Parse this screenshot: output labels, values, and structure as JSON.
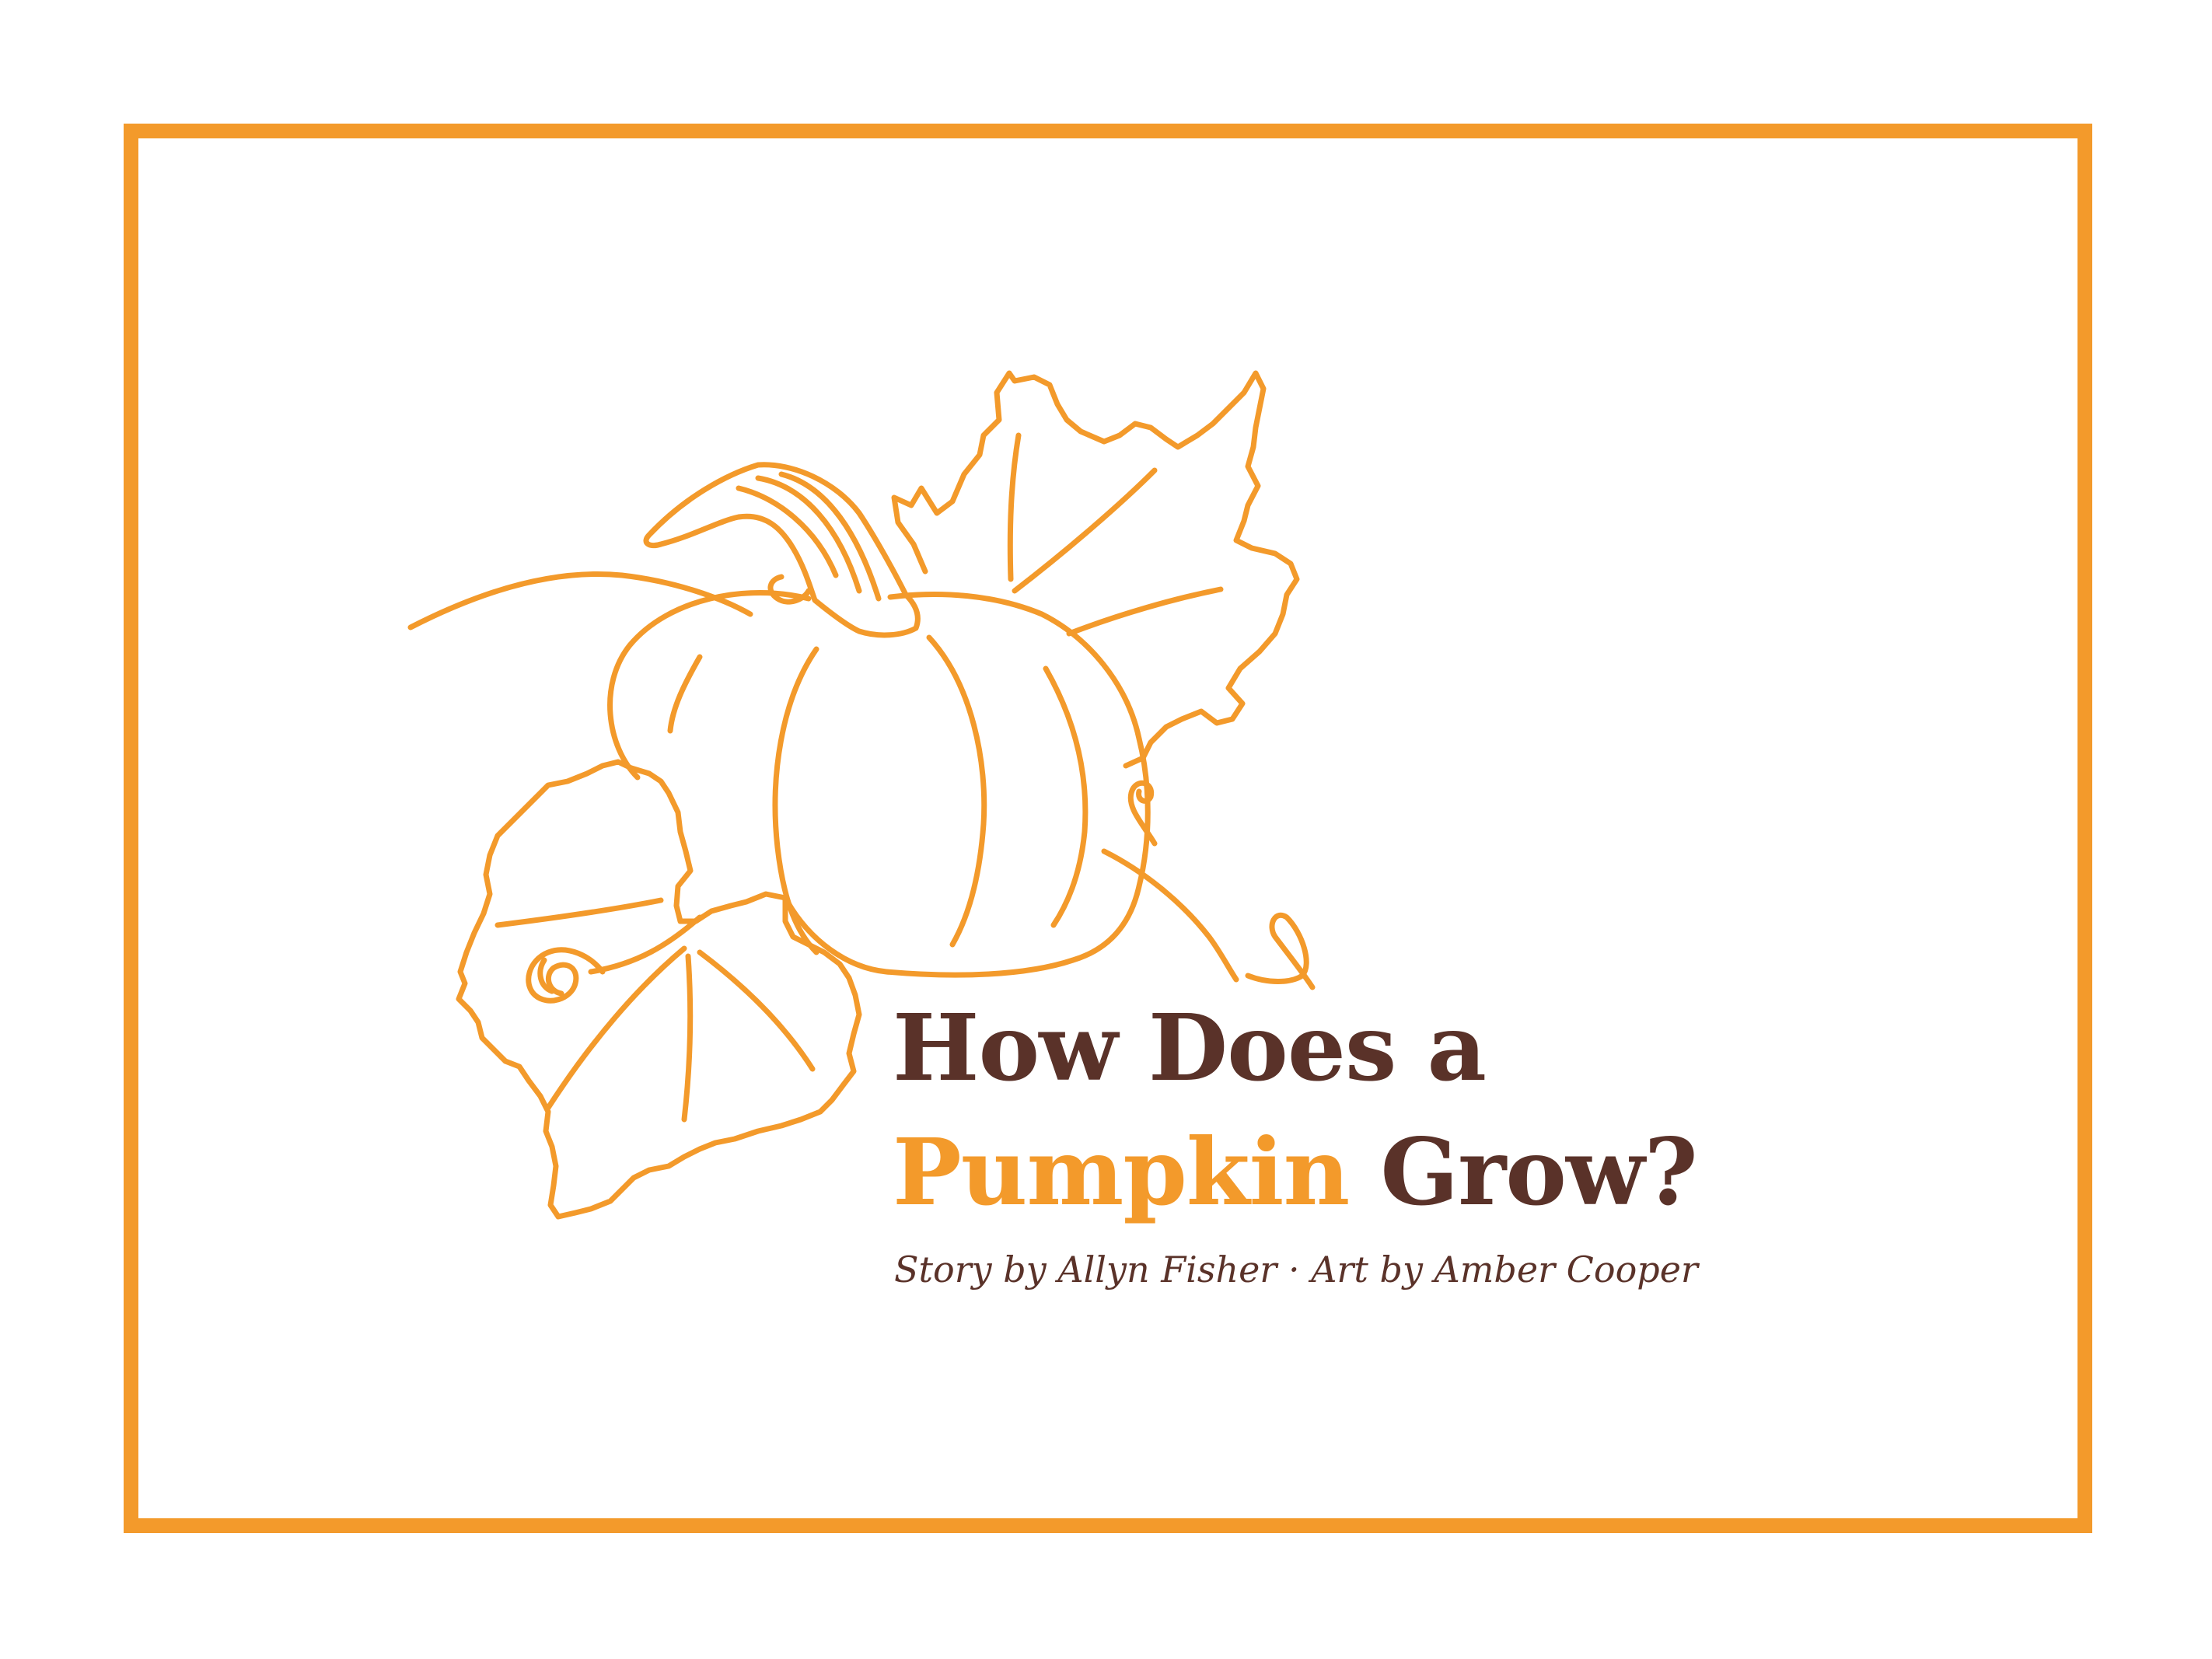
{
  "title": {
    "line1": "How Does a",
    "accent": "Pumpkin",
    "line2_rest": "Grow?"
  },
  "byline": {
    "story": "Story by Allyn Fisher",
    "separator": "·",
    "art": "Art by Amber Cooper"
  },
  "colors": {
    "accent_orange": "#F39A2B",
    "title_brown": "#5A3229",
    "background": "#FFFFFF"
  },
  "illustration": {
    "icon": "pumpkin-with-leaves-line-art"
  }
}
